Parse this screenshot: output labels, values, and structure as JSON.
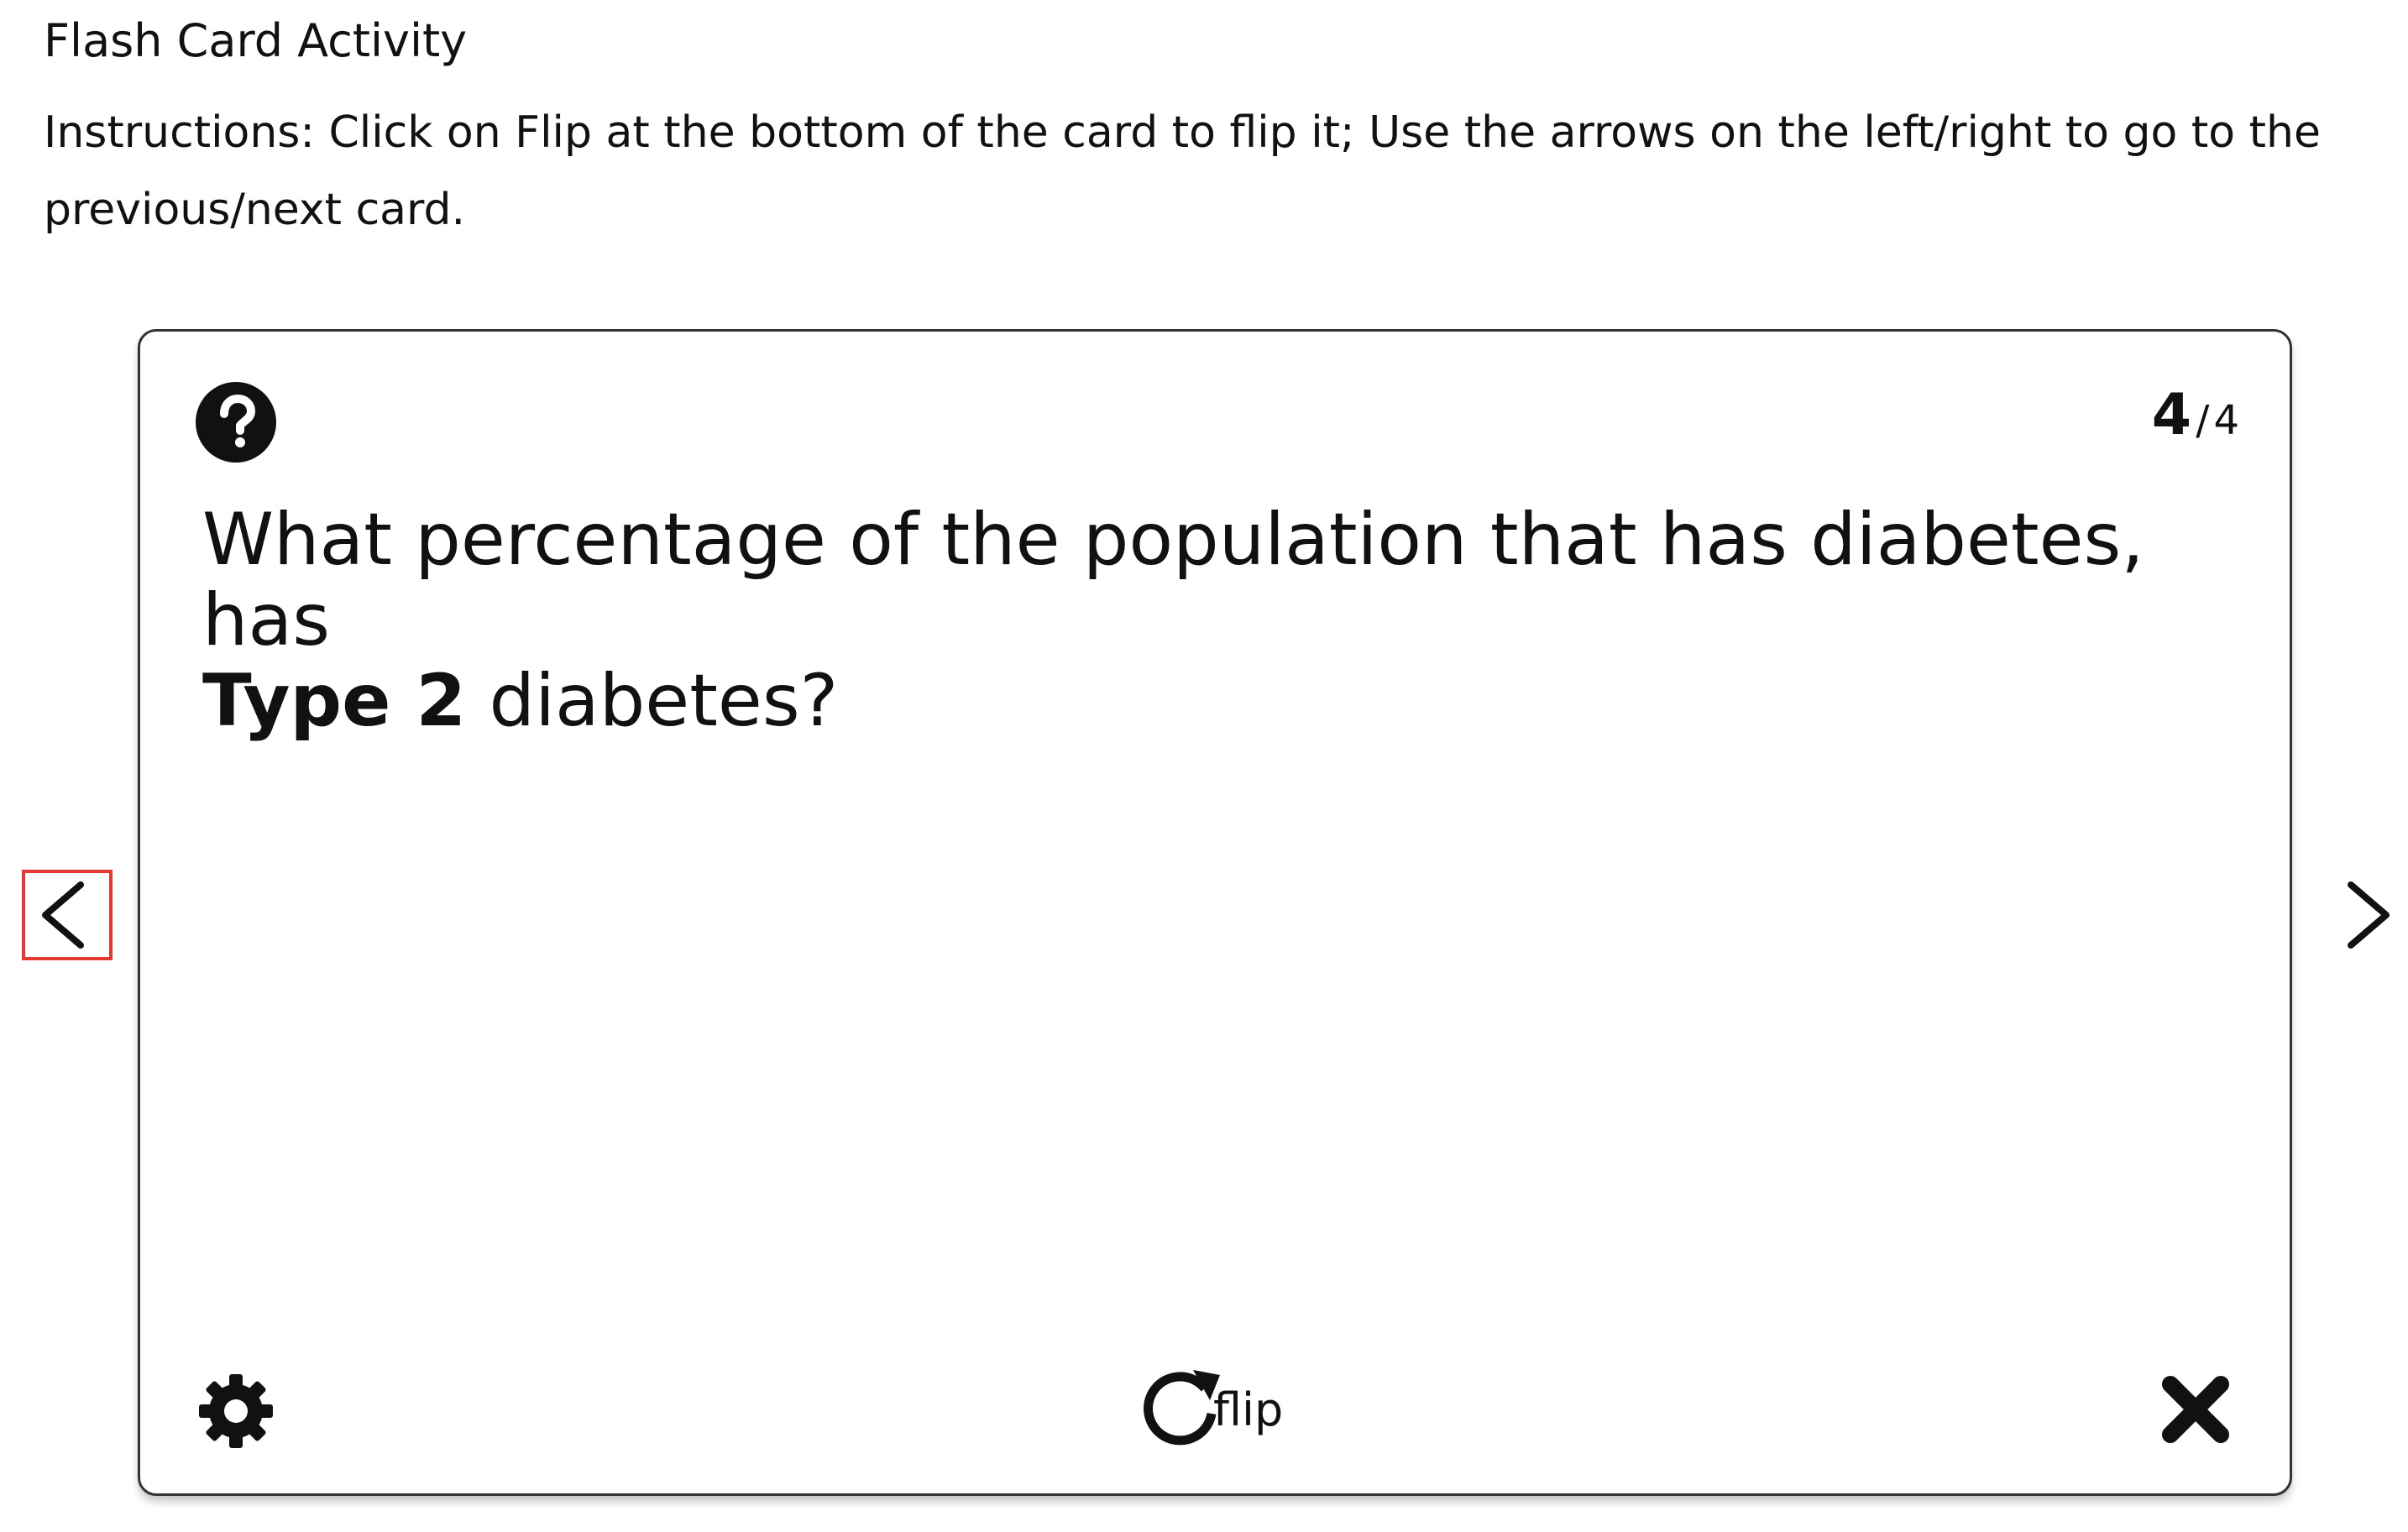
{
  "activity": {
    "title": "Flash Card Activity",
    "instructions": "Instructions: Click on Flip at the bottom of the card to flip it; Use the arrows on the left/right to go to the previous/next card."
  },
  "card": {
    "counter_current": "4",
    "counter_separator": "/",
    "counter_total": "4",
    "question_part1": "What percentage of the population that has diabetes, has",
    "question_bold": "Type 2",
    "question_part2": " diabetes?",
    "flip_label": "flip"
  },
  "icons": {
    "help": "question-circle-icon",
    "settings": "gear-icon",
    "flip": "rotate-cw-icon",
    "close": "close-x-icon",
    "prev": "chevron-left-icon",
    "next": "chevron-right-icon"
  },
  "colors": {
    "highlight_border": "#e53935",
    "card_border": "#333333",
    "text": "#111111"
  }
}
